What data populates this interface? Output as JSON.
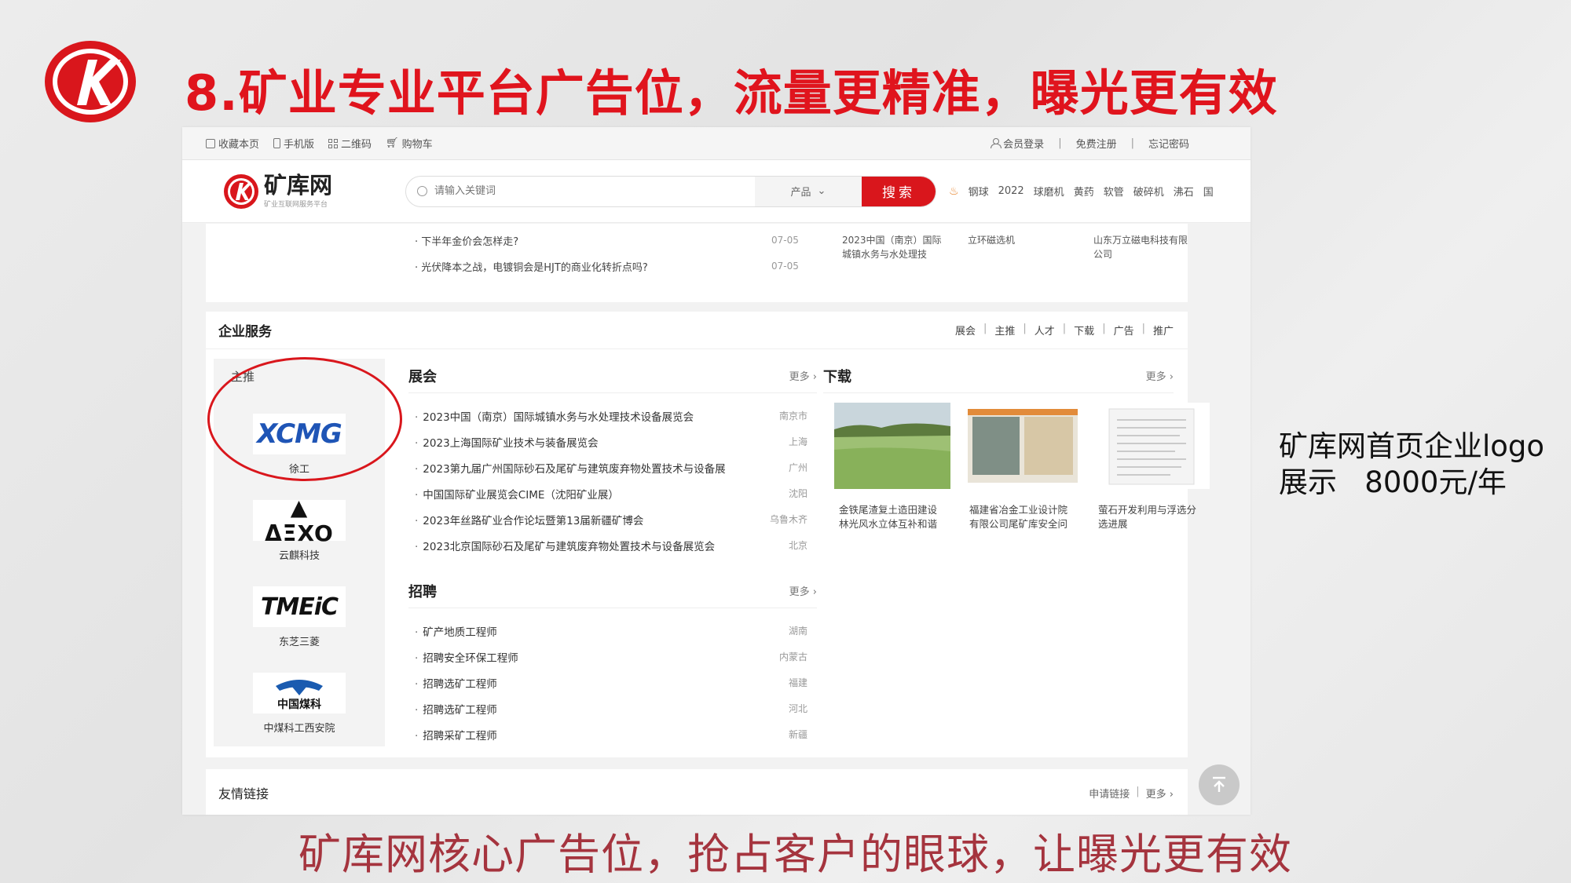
{
  "slide": {
    "title": "8.矿业专业平台广告位，流量更精准，曝光更有效",
    "side_note_line1": "矿库网首页企业logo",
    "side_note_line2": "展示   8000元/年",
    "bottom_tagline": "矿库网核心广告位，抢占客户的眼球，让曝光更有效"
  },
  "topbar": {
    "bookmark": "收藏本页",
    "mobile": "手机版",
    "qrcode": "二维码",
    "cart": "购物车",
    "login": "会员登录",
    "register": "免费注册",
    "forgot": "忘记密码"
  },
  "header": {
    "brand_name": "矿库网",
    "brand_sub": "矿业互联网服务平台",
    "search_placeholder": "请输入关键词",
    "search_type": "产品",
    "search_button": "搜索",
    "hot_keywords": [
      "钢球",
      "2022",
      "球磨机",
      "黄药",
      "软管",
      "破碎机",
      "沸石",
      "国"
    ]
  },
  "news": {
    "items": [
      {
        "title": "下半年金价会怎样走?",
        "date": "07-05"
      },
      {
        "title": "光伏降本之战，电镀铜会是HJT的商业化转折点吗?",
        "date": "07-05"
      }
    ],
    "cards": [
      "2023中国（南京）国际城镇水务与水处理技",
      "立环磁选机",
      "山东万立磁电科技有限公司"
    ]
  },
  "services": {
    "title": "企业服务",
    "links": [
      "展会",
      "主推",
      "人才",
      "下载",
      "广告",
      "推广"
    ],
    "sponsor_label": "主推",
    "sponsors": [
      {
        "logo_text": "XCMG",
        "name": "徐工"
      },
      {
        "logo_text": "ΔΞXO",
        "name": "云麒科技"
      },
      {
        "logo_text": "TMEiC",
        "name": "东芝三菱"
      },
      {
        "logo_text": "中国煤科",
        "name": "中煤科工西安院"
      }
    ],
    "expo": {
      "title": "展会",
      "more": "更多 ›",
      "items": [
        {
          "title": "2023中国（南京）国际城镇水务与水处理技术设备展览会",
          "place": "南京市"
        },
        {
          "title": "2023上海国际矿业技术与装备展览会",
          "place": "上海"
        },
        {
          "title": "2023第九届广州国际砂石及尾矿与建筑废弃物处置技术与设备展",
          "place": "广州"
        },
        {
          "title": "中国国际矿业展览会CIME（沈阳矿业展）",
          "place": "沈阳"
        },
        {
          "title": "2023年丝路矿业合作论坛暨第13届新疆矿博会",
          "place": "乌鲁木齐"
        },
        {
          "title": "2023北京国际砂石及尾矿与建筑废弃物处置技术与设备展览会",
          "place": "北京"
        }
      ]
    },
    "jobs": {
      "title": "招聘",
      "more": "更多 ›",
      "items": [
        {
          "title": "矿产地质工程师",
          "place": "湖南"
        },
        {
          "title": "招聘安全环保工程师",
          "place": "内蒙古"
        },
        {
          "title": "招聘选矿工程师",
          "place": "福建"
        },
        {
          "title": "招聘选矿工程师",
          "place": "河北"
        },
        {
          "title": "招聘采矿工程师",
          "place": "新疆"
        }
      ]
    },
    "downloads": {
      "title": "下载",
      "more": "更多 ›",
      "items": [
        {
          "title": "金铁尾渣复土造田建设林光风水立体互补和谐"
        },
        {
          "title": "福建省冶金工业设计院有限公司尾矿库安全问"
        },
        {
          "title": "萤石开发利用与浮选分选进展"
        }
      ]
    }
  },
  "friend_links": {
    "title": "友情链接",
    "apply": "申请链接",
    "more": "更多 ›"
  },
  "colors": {
    "brand_red": "#e0141d",
    "search_red": "#d9161c",
    "tagline": "#a5343e",
    "xcmg_blue": "#1f55b6"
  }
}
